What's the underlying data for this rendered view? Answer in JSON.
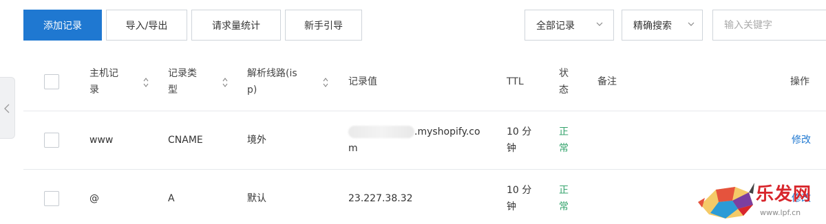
{
  "toolbar": {
    "add_record": "添加记录",
    "import_export": "导入/导出",
    "request_stats": "请求量统计",
    "guide": "新手引导",
    "filter_all": "全部记录",
    "search_mode": "精确搜索",
    "search_placeholder": "输入关键字"
  },
  "table": {
    "headers": {
      "host_line1": "主机记",
      "host_line2": "录",
      "type_line1": "记录类",
      "type_line2": "型",
      "line_line1": "解析线路(is",
      "line_line2": "p)",
      "value": "记录值",
      "ttl": "TTL",
      "status_line1": "状",
      "status_line2": "态",
      "note": "备注",
      "action": "操作"
    },
    "rows": [
      {
        "host": "www",
        "type": "CNAME",
        "line": "境外",
        "value_line1": ".myshopify.co",
        "value_line2": "m",
        "ttl_line1": "10 分",
        "ttl_line2": "钟",
        "status_line1": "正",
        "status_line2": "常",
        "action": "修改"
      },
      {
        "host": "@",
        "type": "A",
        "line": "默认",
        "value": "23.227.38.32",
        "ttl_line1": "10 分",
        "ttl_line2": "钟",
        "status_line1": "正",
        "status_line2": "常",
        "action": "修改"
      }
    ]
  },
  "watermark": {
    "text": "乐发网",
    "url": "www.lpf.cn"
  },
  "colors": {
    "primary": "#1f78d1",
    "status_normal": "#33a36b",
    "watermark_red": "#d8262c"
  }
}
